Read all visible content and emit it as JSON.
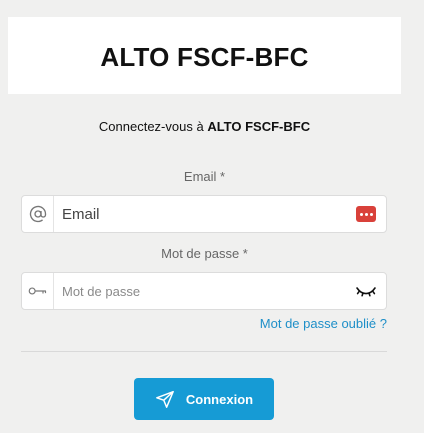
{
  "header": {
    "title": "ALTO FSCF-BFC"
  },
  "subtitle": {
    "prefix": "Connectez-vous à ",
    "app_name": "ALTO FSCF-BFC"
  },
  "email": {
    "label": "Email *",
    "placeholder": "Email",
    "value": "",
    "prefix_icon": "at-sign-icon",
    "suffix_icon": "password-manager-icon"
  },
  "password": {
    "label": "Mot de passe *",
    "placeholder": "Mot de passe",
    "value": "",
    "prefix_icon": "key-icon",
    "suffix_icon": "eye-closed-icon"
  },
  "forgot_password": "Mot de passe oublié ?",
  "login_button": {
    "label": "Connexion",
    "icon": "send-icon"
  },
  "colors": {
    "background": "#f0f0ef",
    "accent": "#169bd5",
    "link": "#1e8fc8",
    "password_manager": "#d9413a"
  }
}
